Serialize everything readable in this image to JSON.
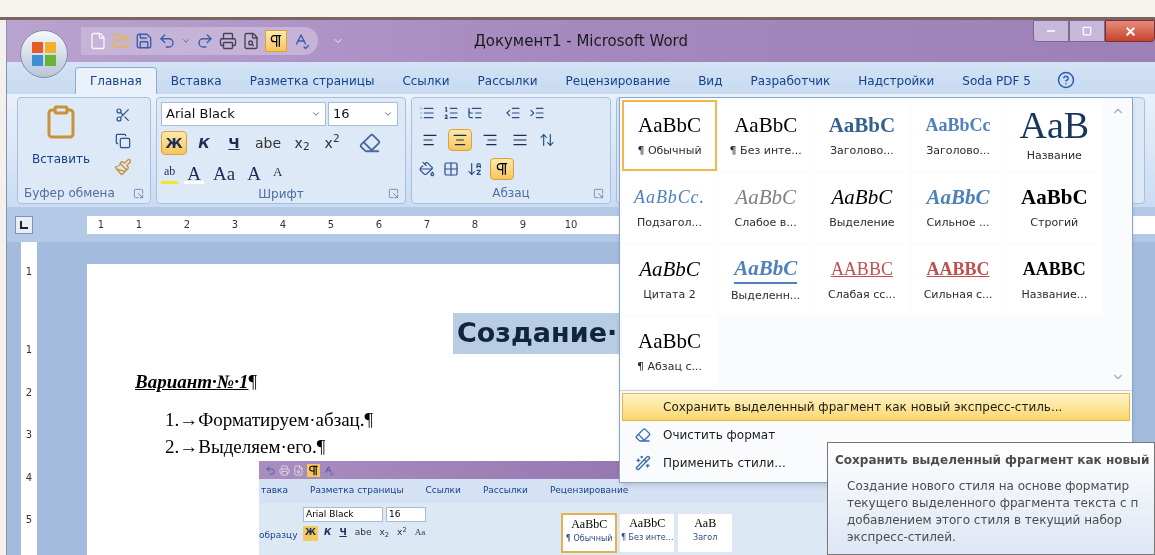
{
  "window": {
    "title": "Документ1 - Microsoft Word"
  },
  "quick_access": {
    "marks_on": true
  },
  "tabs": [
    {
      "label": "Главная",
      "selected": true
    },
    {
      "label": "Вставка",
      "selected": false
    },
    {
      "label": "Разметка страницы",
      "selected": false
    },
    {
      "label": "Ссылки",
      "selected": false
    },
    {
      "label": "Рассылки",
      "selected": false
    },
    {
      "label": "Рецензирование",
      "selected": false
    },
    {
      "label": "Вид",
      "selected": false
    },
    {
      "label": "Разработчик",
      "selected": false
    },
    {
      "label": "Надстройки",
      "selected": false
    },
    {
      "label": "Soda PDF 5",
      "selected": false
    }
  ],
  "clipboard": {
    "paste": "Вставить",
    "group": "Буфер обмена"
  },
  "font": {
    "name": "Arial Black",
    "size": "16",
    "group": "Шрифт",
    "row2": [
      {
        "kind": "bold",
        "label": "Ж",
        "selected": true
      },
      {
        "kind": "italic",
        "label": "К",
        "selected": false
      },
      {
        "kind": "underline",
        "label": "Ч",
        "selected": false
      },
      {
        "kind": "strike",
        "label": "abe",
        "selected": false
      },
      {
        "kind": "subscript",
        "label": "x$_{2}$",
        "selected": false
      },
      {
        "kind": "superscript",
        "label": "x$^{2}$",
        "selected": false
      }
    ],
    "row3": [
      {
        "kind": "highlight",
        "label": "ab"
      },
      {
        "kind": "color",
        "label": "A"
      },
      {
        "kind": "case",
        "label": "Aa"
      },
      {
        "kind": "grow",
        "label": "A"
      },
      {
        "kind": "shrink",
        "label": "A"
      }
    ]
  },
  "paragraph": {
    "group": "Абзац",
    "align": [
      {
        "kind": "left",
        "selected": false
      },
      {
        "kind": "center",
        "selected": true
      },
      {
        "kind": "right",
        "selected": false
      },
      {
        "kind": "justify",
        "selected": false
      }
    ],
    "marks_on": true
  },
  "ruler": {
    "numbers": [
      "1",
      "1",
      "2",
      "3",
      "4",
      "5",
      "6",
      "7",
      "8",
      "9",
      "10"
    ]
  },
  "vertical_ruler": {
    "numbers": [
      "1",
      "1",
      "2",
      "3",
      "4",
      "5"
    ]
  },
  "document": {
    "heading": "Создание·",
    "variant": "Вариант·№·1",
    "variant_mark": "¶",
    "items": [
      "1.→Форматируем·абзац.¶",
      "2.→Выделяем·его.¶"
    ]
  },
  "pasted_screenshot": {
    "marks_on": true,
    "tabs": [
      "тавка",
      "Разметка страницы",
      "Ссылки",
      "Рассылки",
      "Рецензирование"
    ],
    "side_label": "образцу",
    "font_name": "Arial Black",
    "font_size": "16",
    "buttons": [
      {
        "kind": "bold",
        "label": "Ж",
        "selected": true
      },
      {
        "kind": "italic",
        "label": "К",
        "selected": false
      },
      {
        "kind": "underline",
        "label": "Ч",
        "selected": false
      },
      {
        "kind": "strike",
        "label": "abe",
        "selected": false
      },
      {
        "kind": "subscript",
        "label": "x$_{2}$",
        "selected": false
      },
      {
        "kind": "superscript",
        "label": "x$^{2}$",
        "selected": false
      },
      {
        "kind": "case",
        "label": "Aa",
        "selected": false
      }
    ],
    "styles": [
      {
        "preview": "AaBbC",
        "label": "¶ Обычный",
        "selected": true
      },
      {
        "preview": "AaBbC",
        "label": "¶ Без инте...",
        "selected": false
      },
      {
        "preview": "AaB",
        "label": "Загол",
        "selected": false
      }
    ]
  },
  "styles_gallery": {
    "items": [
      {
        "kind": "normal",
        "preview": "AaBbC",
        "label": "¶ Обычный",
        "selected": true
      },
      {
        "kind": "normal",
        "preview": "AaBbC",
        "label": "¶ Без инте...",
        "selected": false
      },
      {
        "kind": "heading1",
        "preview": "AaBbC",
        "label": "Заголово...",
        "selected": false
      },
      {
        "kind": "heading2",
        "preview": "AaBbCc",
        "label": "Заголово...",
        "selected": false
      },
      {
        "kind": "title",
        "preview": "AaB",
        "label": "Название",
        "selected": false
      },
      {
        "kind": "subtitle",
        "preview": "AaBbCc.",
        "label": "Подзагол...",
        "selected": false
      },
      {
        "kind": "subtle",
        "preview": "AaBbC",
        "label": "Слабое в...",
        "selected": false
      },
      {
        "kind": "emphasis",
        "preview": "AaBbC",
        "label": "Выделение",
        "selected": false
      },
      {
        "kind": "intense",
        "preview": "AaBbC",
        "label": "Сильное ...",
        "selected": false
      },
      {
        "kind": "strong",
        "preview": "AaBbC",
        "label": "Строгий",
        "selected": false
      },
      {
        "kind": "quote",
        "preview": "AaBbC",
        "label": "Цитата 2",
        "selected": false
      },
      {
        "kind": "intensequote",
        "preview": "AaBbC",
        "label": "Выделенн...",
        "selected": false
      },
      {
        "kind": "subtleref",
        "preview": "AABBC",
        "label": "Слабая сс...",
        "selected": false
      },
      {
        "kind": "intenseref",
        "preview": "AABBC",
        "label": "Сильная с...",
        "selected": false
      },
      {
        "kind": "booktitle",
        "preview": "AABBC",
        "label": "Название...",
        "selected": false
      },
      {
        "kind": "normal",
        "preview": "AaBbC",
        "label": "¶ Абзац с...",
        "selected": false
      }
    ],
    "menu": [
      {
        "kind": "save",
        "label": "Сохранить выделенный фрагмент как новый экспресс-стиль...",
        "selected": true
      },
      {
        "kind": "clear",
        "label": "Очистить формат",
        "selected": false
      },
      {
        "kind": "apply",
        "label": "Применить стили...",
        "selected": false
      }
    ]
  },
  "tooltip": {
    "title": "Сохранить выделенный фрагмент как новый",
    "lines": [
      "Создание нового стиля на основе форматир",
      "текущего выделенного фрагмента текста с п",
      "добавлением этого стиля в текущий набор",
      "экспресс-стилей."
    ]
  }
}
